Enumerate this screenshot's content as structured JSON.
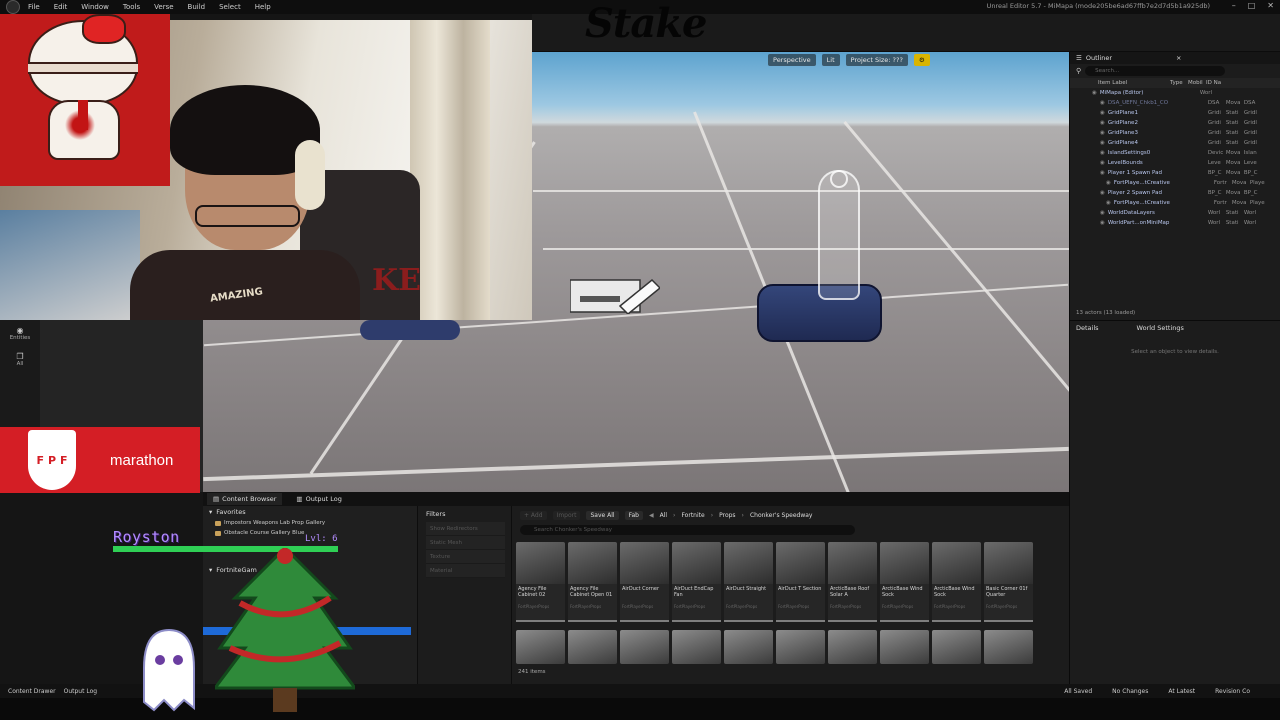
{
  "menubar": {
    "items": [
      "File",
      "Edit",
      "Window",
      "Tools",
      "Verse",
      "Build",
      "Select",
      "Help"
    ],
    "title": "Unreal Editor 5.7 - MiMapa (mode205be6ad67ffb7e2d7d5b1a925db)"
  },
  "overlay": {
    "stake": "Stake",
    "fpf_letters": [
      "F",
      "P",
      "F"
    ],
    "fpf_text": "marathon",
    "royston": "Royston",
    "royston_level": "Lvl: 6",
    "chair_text": "KE",
    "shirt_text": "AMAZING"
  },
  "viewport": {
    "perspective": "Perspective",
    "lit": "Lit",
    "project_size": "Project Size: ???"
  },
  "left_modes": [
    {
      "label": "Entities",
      "icon": "entities-icon",
      "glyph": "◉"
    },
    {
      "label": "All",
      "icon": "layers-icon",
      "glyph": "❐"
    }
  ],
  "outliner": {
    "tab": "Outliner",
    "search_placeholder": "Search...",
    "headers": [
      "Item Label",
      "Type",
      "Mobil",
      "ID Na"
    ],
    "rows": [
      {
        "label": "MiMapa (Editor)",
        "type": "Worl",
        "mob": "",
        "id": "",
        "indent": 22
      },
      {
        "label": "DSA_UEFN_Chkb1_CO",
        "type": "DSA",
        "mob": "Mova",
        "id": "DSA",
        "indent": 30,
        "dim": true
      },
      {
        "label": "GridPlane1",
        "type": "Gridi",
        "mob": "Stati",
        "id": "Gridl",
        "indent": 30
      },
      {
        "label": "GridPlane2",
        "type": "Gridi",
        "mob": "Stati",
        "id": "Gridl",
        "indent": 30
      },
      {
        "label": "GridPlane3",
        "type": "Gridi",
        "mob": "Stati",
        "id": "Gridl",
        "indent": 30
      },
      {
        "label": "GridPlane4",
        "type": "Gridi",
        "mob": "Stati",
        "id": "Gridl",
        "indent": 30
      },
      {
        "label": "IslandSettings0",
        "type": "Devic",
        "mob": "Mova",
        "id": "Islan",
        "indent": 30
      },
      {
        "label": "LevelBounds",
        "type": "Leve",
        "mob": "Mova",
        "id": "Leve",
        "indent": 30
      },
      {
        "label": "Player 1 Spawn Pad",
        "type": "BP_C",
        "mob": "Mova",
        "id": "BP_C",
        "indent": 30
      },
      {
        "label": "FortPlaye...tCreative",
        "type": "Fortr",
        "mob": "Mova",
        "id": "Playe",
        "indent": 36
      },
      {
        "label": "Player 2 Spawn Pad",
        "type": "BP_C",
        "mob": "Mova",
        "id": "BP_C",
        "indent": 30
      },
      {
        "label": "FortPlaye...tCreative",
        "type": "Fortr",
        "mob": "Mova",
        "id": "Playe",
        "indent": 36
      },
      {
        "label": "WorldDataLayers",
        "type": "Worl",
        "mob": "Stati",
        "id": "Worl",
        "indent": 30
      },
      {
        "label": "WorldPart...onMiniMap",
        "type": "Worl",
        "mob": "Stati",
        "id": "Worl",
        "indent": 30
      }
    ],
    "footer": "13 actors (13 loaded)"
  },
  "details": {
    "tab": "Details",
    "tab2": "World Settings",
    "empty": "Select an object to view details."
  },
  "content_browser": {
    "tab": "Content Browser",
    "tab2": "Output Log",
    "favorites": "Favorites",
    "fav_items": [
      "Impostors Weapons Lab Prop Gallery",
      "Obstacle Course Gallery Blue"
    ],
    "section2": "FortniteGam",
    "filters_title": "Filters",
    "filters": [
      "Show Redirectors",
      "Static Mesh",
      "Texture",
      "Material"
    ],
    "add": "+ Add",
    "import": "Import",
    "save_all": "Save All",
    "fab": "Fab",
    "breadcrumbs": [
      "All",
      "Fortnite",
      "Props",
      "Chonker's Speedway"
    ],
    "search_placeholder": "Search Chonker's Speedway",
    "assets": [
      {
        "name": "Agency File Cabinet 02",
        "path": "FortPlayerProps"
      },
      {
        "name": "Agency File Cabinet Open 01",
        "path": "FortPlayerProps"
      },
      {
        "name": "AirDuct Corner",
        "path": "FortPlayerProps"
      },
      {
        "name": "AirDuct EndCap Fan",
        "path": "FortPlayerProps"
      },
      {
        "name": "AirDuct Straight",
        "path": "FortPlayerProps"
      },
      {
        "name": "AirDuct T Section",
        "path": "FortPlayerProps"
      },
      {
        "name": "ArcticBase Roof Solar A",
        "path": "FortPlayerProps"
      },
      {
        "name": "ArcticBase Wind Sock",
        "path": "FortPlayerProps"
      },
      {
        "name": "ArcticBase Wind Sock",
        "path": "FortPlayerProps"
      },
      {
        "name": "Basic Corner 01f Quarter",
        "path": "FortPlayerProps"
      }
    ],
    "item_count": "241 items"
  },
  "statusbar": {
    "content_drawer": "Content Drawer",
    "output_log": "Output Log",
    "all_saved": "All Saved",
    "no_changes": "No Changes",
    "at_latest": "At Latest",
    "revision": "Revision Co"
  },
  "colors": {
    "accent_yellow": "#d9b400",
    "fpf_red": "#d41e25",
    "kitty_red": "#c01b1b",
    "royston_purple": "#b38cff",
    "hp_green": "#2fcf55"
  }
}
